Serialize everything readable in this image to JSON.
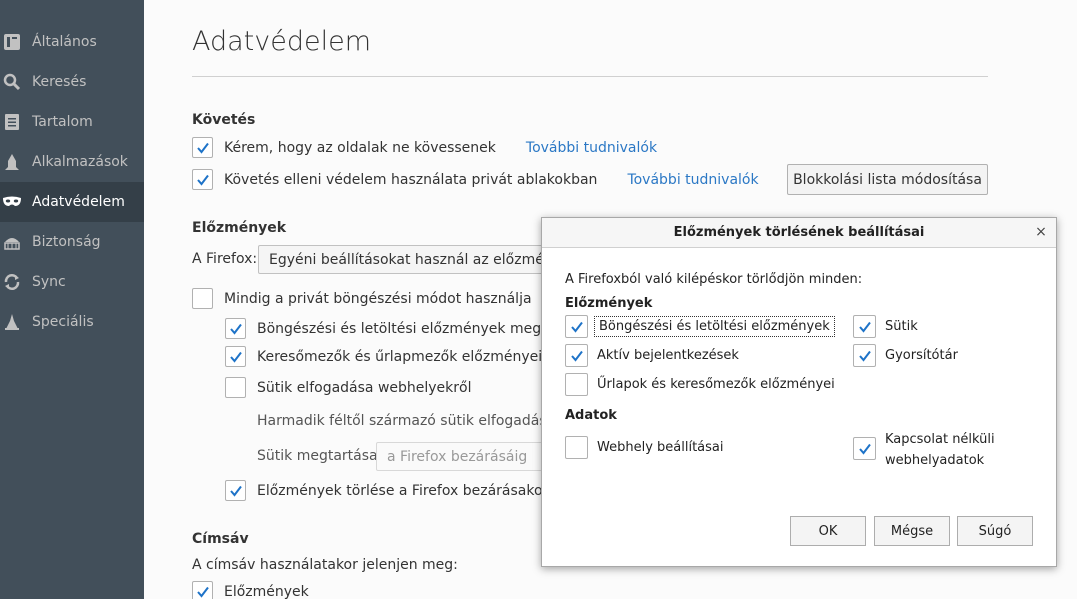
{
  "sidebar": {
    "items": [
      {
        "label": "Általános",
        "icon": "general-icon"
      },
      {
        "label": "Keresés",
        "icon": "search-icon"
      },
      {
        "label": "Tartalom",
        "icon": "content-icon"
      },
      {
        "label": "Alkalmazások",
        "icon": "applications-icon"
      },
      {
        "label": "Adatvédelem",
        "icon": "privacy-mask-icon",
        "active": true
      },
      {
        "label": "Biztonság",
        "icon": "security-icon"
      },
      {
        "label": "Sync",
        "icon": "sync-icon"
      },
      {
        "label": "Speciális",
        "icon": "advanced-icon"
      }
    ]
  },
  "main": {
    "title": "Adatvédelem",
    "tracking": {
      "heading": "Követés",
      "dnt_label": "Kérem, hogy az oldalak ne kövessenek",
      "dnt_checked": true,
      "dnt_link": "További tudnivalók",
      "tp_label": "Követés elleni védelem használata privát ablakokban",
      "tp_checked": true,
      "tp_link": "További tudnivalók",
      "blocklist_button": "Blokkolási lista módosítása"
    },
    "history": {
      "heading": "Előzmények",
      "firefox_label": "A Firefox:",
      "firefox_select": "Egyéni beállításokat használ az előzmény",
      "private_mode_label": "Mindig a privát böngészési módot használja",
      "private_mode_checked": false,
      "browse_history_label": "Böngészési és letöltési előzmények megőrz",
      "browse_history_checked": true,
      "search_form_label": "Keresőmezők és űrlapmezők előzményeine",
      "search_form_checked": true,
      "cookies_label": "Sütik elfogadása webhelyekről",
      "cookies_checked": false,
      "third_party_label": "Harmadik féltől származó sütik elfogadása",
      "keep_until_label": "Sütik megtartása:",
      "keep_until_select": "a Firefox bezárásáig",
      "clear_on_close_label": "Előzmények törlése a Firefox bezárásakor",
      "clear_on_close_checked": true
    },
    "location_bar": {
      "heading": "Címsáv",
      "description": "A címsáv használatakor jelenjen meg:",
      "history_label": "Előzmények",
      "history_checked": true
    }
  },
  "dialog": {
    "title": "Előzmények törlésének beállításai",
    "close_glyph": "×",
    "intro": "A Firefoxból való kilépéskor törlődjön minden:",
    "history_heading": "Előzmények",
    "items_history": [
      {
        "label": "Böngészési és letöltési előzmények",
        "checked": true
      },
      {
        "label": "Sütik",
        "checked": true
      },
      {
        "label": "Aktív bejelentkezések",
        "checked": true
      },
      {
        "label": "Gyorsítótár",
        "checked": true
      },
      {
        "label": "Űrlapok és keresőmezők előzményei",
        "checked": false
      }
    ],
    "data_heading": "Adatok",
    "items_data": [
      {
        "label": "Webhely beállításai",
        "checked": false
      },
      {
        "label_line1": "Kapcsolat nélküli",
        "label_line2": "webhelyadatok",
        "checked": true
      }
    ],
    "buttons": {
      "ok": "OK",
      "cancel": "Mégse",
      "help": "Súgó"
    }
  },
  "colors": {
    "sidebar_bg": "#424f5a",
    "sidebar_active": "#343f48",
    "link": "#2b78c5",
    "check": "#1e73c8"
  }
}
